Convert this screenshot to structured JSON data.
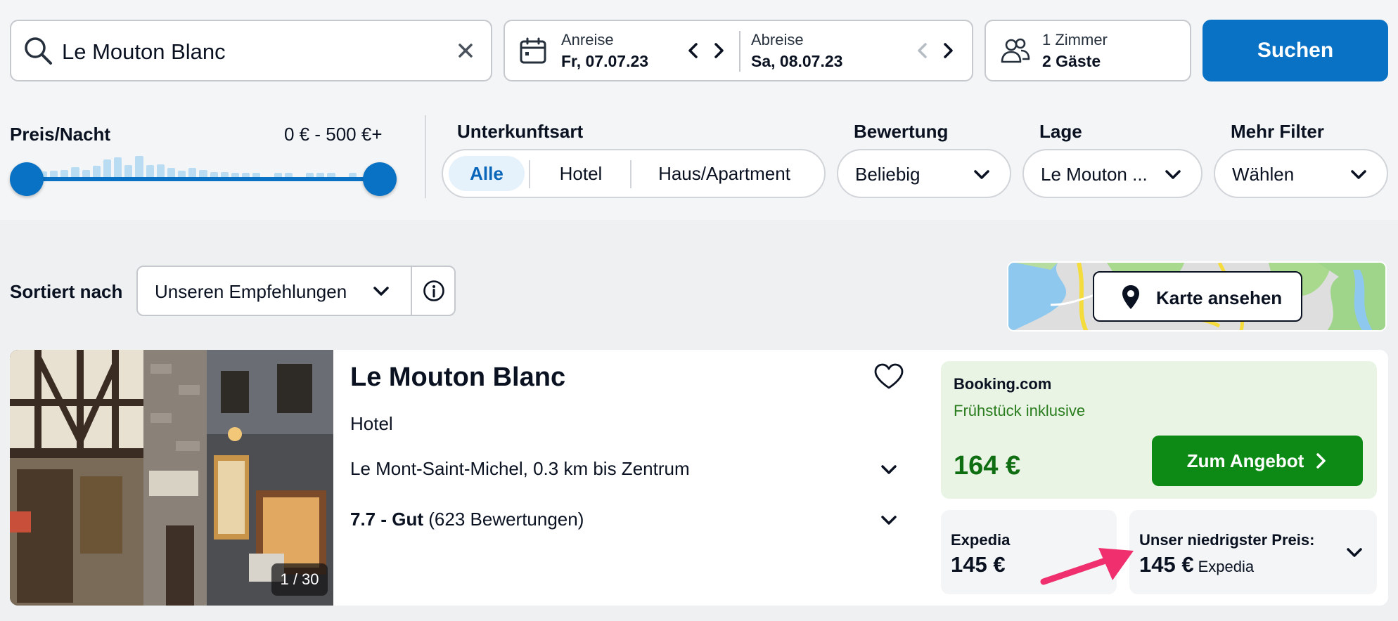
{
  "search": {
    "query": "Le Mouton Blanc"
  },
  "dates": {
    "checkin_label": "Anreise",
    "checkin_value": "Fr, 07.07.23",
    "checkout_label": "Abreise",
    "checkout_value": "Sa, 08.07.23"
  },
  "guests": {
    "rooms": "1 Zimmer",
    "people": "2 Gäste"
  },
  "search_button": "Suchen",
  "filters": {
    "price_label": "Preis/Nacht",
    "price_range": "0 € - 500 €+",
    "price_min_fraction": 0,
    "price_max_fraction": 1,
    "histogram": [
      0.18,
      0.2,
      0.22,
      0.3,
      0.22,
      0.35,
      0.55,
      0.6,
      0.38,
      0.66,
      0.36,
      0.4,
      0.28,
      0.2,
      0.28,
      0.22,
      0.16,
      0.16,
      0.14,
      0.14,
      0.14,
      0,
      0.14,
      0.14,
      0,
      0.14,
      0.14,
      0.14,
      0,
      0.14,
      0
    ],
    "type_label": "Unterkunftsart",
    "type_options": [
      "Alle",
      "Hotel",
      "Haus/Apartment"
    ],
    "type_active": "Alle",
    "rating_label": "Bewertung",
    "rating_value": "Beliebig",
    "location_label": "Lage",
    "location_value": "Le Mouton ...",
    "more_label": "Mehr Filter",
    "more_value": "Wählen"
  },
  "sort": {
    "label": "Sortiert nach",
    "value": "Unseren Empfehlungen"
  },
  "map_button": "Karte ansehen",
  "hotel": {
    "name": "Le Mouton Blanc",
    "type": "Hotel",
    "location": "Le Mont-Saint-Michel, 0.3 km bis Zentrum",
    "rating_score": "7.7 - Gut",
    "rating_count": "(623 Bewertungen)",
    "photo_counter": "1 / 30"
  },
  "deals": {
    "main": {
      "provider": "Booking.com",
      "note": "Frühstück inklusive",
      "price": "164 €",
      "button": "Zum Angebot"
    },
    "alt": {
      "provider": "Expedia",
      "price": "145 €"
    },
    "lowest": {
      "label": "Unser niedrigster Preis:",
      "price": "145 €",
      "source": "Expedia"
    }
  },
  "colors": {
    "primary_blue": "#0a72c4",
    "deal_green": "#0c8a15",
    "annotation_pink": "#f0306e"
  }
}
